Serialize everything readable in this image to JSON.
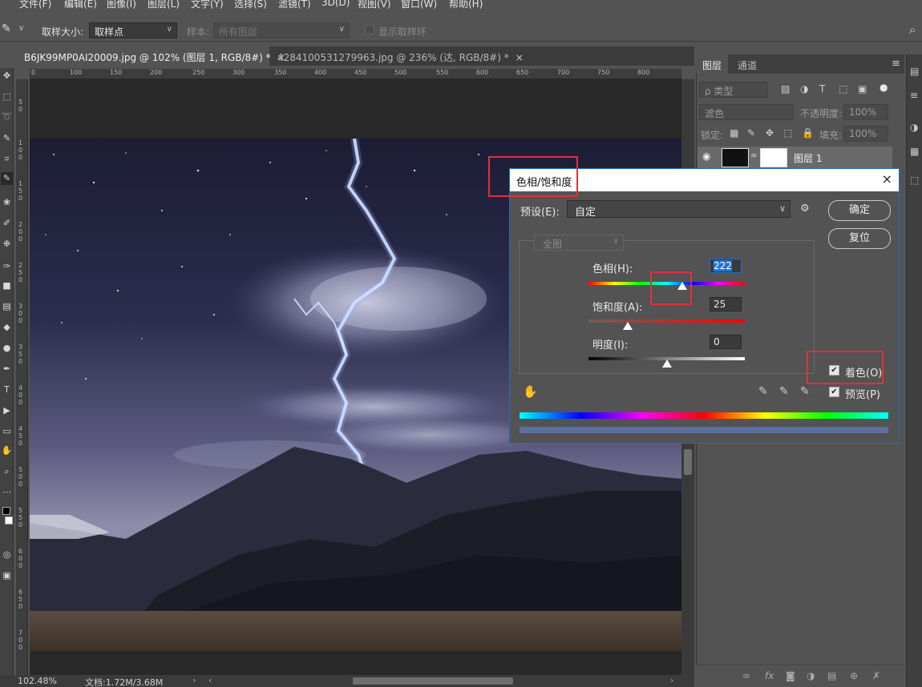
{
  "menu": [
    "文件(F)",
    "编辑(E)",
    "图像(I)",
    "图层(L)",
    "文字(Y)",
    "选择(S)",
    "滤镜(T)",
    "3D(D)",
    "视图(V)",
    "窗口(W)",
    "帮助(H)"
  ],
  "options": {
    "sample_size_label": "取样大小:",
    "sample_size_value": "取样点",
    "sample_label": "样本:",
    "sample_value": "所有图层",
    "show_ring_label": "显示取样环"
  },
  "tabs": [
    {
      "label": "B6JK99MP0AI20009.jpg @ 102% (图层 1, RGB/8#) *",
      "close": "×"
    },
    {
      "label": "4284100531279963.jpg @ 236% (达, RGB/8#) *",
      "close": "×"
    }
  ],
  "ruler_h": [
    "0",
    "100",
    "150",
    "200",
    "250",
    "300",
    "350",
    "400",
    "450",
    "500",
    "550",
    "600",
    "650",
    "700",
    "750",
    "800"
  ],
  "ruler_v": [
    "5\n0",
    "1\n0\n0",
    "1\n5\n0",
    "2\n0\n0",
    "2\n5\n0",
    "3\n0\n0",
    "3\n5\n0",
    "4\n0\n0",
    "4\n5\n0",
    "5\n0\n0",
    "5\n5\n0",
    "6\n0\n0",
    "6\n5\n0",
    "7\n0\n0"
  ],
  "status": {
    "zoom": "102.48%",
    "doc": "文档:1.72M/3.68M"
  },
  "layers_panel": {
    "tab_layers": "图层",
    "tab_channels": "通道",
    "filter_kind": "ρ 类型",
    "blend_mode": "滤色",
    "opacity_label": "不透明度:",
    "opacity_value": "100%",
    "lock_label": "锁定:",
    "fill_label": "填充:",
    "fill_value": "100%",
    "layer_name": "图层 1"
  },
  "dialog": {
    "title": "色相/饱和度",
    "close": "×",
    "preset_label": "预设(E):",
    "preset_value": "自定",
    "ok": "确定",
    "reset": "复位",
    "channel": "全图",
    "hue_label": "色相(H):",
    "hue_value": "222",
    "saturation_label": "饱和度(A):",
    "saturation_value": "25",
    "lightness_label": "明度(I):",
    "lightness_value": "0",
    "colorize_label": "着色(O)",
    "colorize_checked": true,
    "preview_label": "预览(P)",
    "preview_checked": true,
    "hue_position": 0.6,
    "saturation_position": 0.25,
    "lightness_position": 0.5
  }
}
